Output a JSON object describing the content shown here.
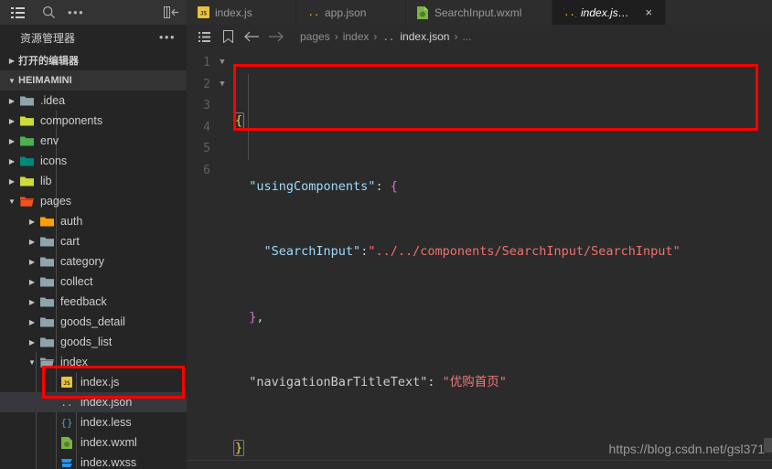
{
  "activity_bar": {
    "icons": [
      {
        "name": "menu-icon",
        "glyph": "menu"
      },
      {
        "name": "search-icon",
        "glyph": "search"
      },
      {
        "name": "more-actions-icon",
        "glyph": "ellipsis"
      }
    ],
    "collapse_label": "collapse-sidebar-icon"
  },
  "tabs": [
    {
      "label": "index.js",
      "icon": "js-file-icon",
      "active": false,
      "closable": false
    },
    {
      "label": "app.json",
      "icon": "json-file-icon",
      "active": false,
      "closable": false
    },
    {
      "label": "SearchInput.wxml",
      "icon": "wxml-file-icon",
      "active": false,
      "closable": false
    },
    {
      "label": "index.json",
      "icon": "json-file-icon",
      "active": true,
      "closable": true,
      "close_label": "×"
    }
  ],
  "sidebar": {
    "title": "资源管理器",
    "more_label": "•••",
    "sections": [
      {
        "label": "打开的编辑器",
        "expanded": false
      },
      {
        "label": "HEIMAMINI",
        "expanded": true
      }
    ],
    "tree": [
      {
        "label": ".idea",
        "depth": 1,
        "type": "folder",
        "color": "#90a4ae",
        "expanded": false,
        "selected": false
      },
      {
        "label": "components",
        "depth": 1,
        "type": "folder",
        "color": "#cddc39",
        "expanded": false,
        "selected": false
      },
      {
        "label": "env",
        "depth": 1,
        "type": "folder",
        "color": "#4caf50",
        "expanded": false,
        "selected": false
      },
      {
        "label": "icons",
        "depth": 1,
        "type": "folder",
        "color": "#00897b",
        "expanded": false,
        "selected": false
      },
      {
        "label": "lib",
        "depth": 1,
        "type": "folder",
        "color": "#cddc39",
        "expanded": false,
        "selected": false
      },
      {
        "label": "pages",
        "depth": 1,
        "type": "folder",
        "color": "#f4511e",
        "expanded": true,
        "selected": false
      },
      {
        "label": "auth",
        "depth": 2,
        "type": "folder",
        "color": "#ffa000",
        "expanded": false,
        "selected": false
      },
      {
        "label": "cart",
        "depth": 2,
        "type": "folder",
        "color": "#90a4ae",
        "expanded": false,
        "selected": false
      },
      {
        "label": "category",
        "depth": 2,
        "type": "folder",
        "color": "#90a4ae",
        "expanded": false,
        "selected": false
      },
      {
        "label": "collect",
        "depth": 2,
        "type": "folder",
        "color": "#90a4ae",
        "expanded": false,
        "selected": false
      },
      {
        "label": "feedback",
        "depth": 2,
        "type": "folder",
        "color": "#90a4ae",
        "expanded": false,
        "selected": false
      },
      {
        "label": "goods_detail",
        "depth": 2,
        "type": "folder",
        "color": "#90a4ae",
        "expanded": false,
        "selected": false
      },
      {
        "label": "goods_list",
        "depth": 2,
        "type": "folder",
        "color": "#90a4ae",
        "expanded": false,
        "selected": false
      },
      {
        "label": "index",
        "depth": 2,
        "type": "folder",
        "color": "#90a4ae",
        "expanded": true,
        "selected": false
      },
      {
        "label": "index.js",
        "depth": 3,
        "type": "js",
        "selected": false
      },
      {
        "label": "index.json",
        "depth": 3,
        "type": "json",
        "selected": true
      },
      {
        "label": "index.less",
        "depth": 3,
        "type": "less",
        "selected": false
      },
      {
        "label": "index.wxml",
        "depth": 3,
        "type": "wxml",
        "selected": false
      },
      {
        "label": "index.wxss",
        "depth": 3,
        "type": "wxss",
        "selected": false
      }
    ]
  },
  "breadcrumb": {
    "icons": [
      "outline-icon",
      "bookmark-icon",
      "back-arrow-icon",
      "forward-arrow-icon"
    ],
    "segments": [
      "pages",
      "index"
    ],
    "file": "index.json",
    "trailing": "...",
    "separator": "›"
  },
  "editor": {
    "lines": [
      {
        "number": "1",
        "foldable": true
      },
      {
        "number": "2",
        "foldable": true
      },
      {
        "number": "3",
        "foldable": false
      },
      {
        "number": "4",
        "foldable": false
      },
      {
        "number": "5",
        "foldable": false
      },
      {
        "number": "6",
        "foldable": false
      }
    ],
    "code": {
      "line1_brace": "{",
      "line2_key": "\"usingComponents\"",
      "line2_colon": ": ",
      "line2_brace": "{",
      "line3_key": "\"SearchInput\"",
      "line3_colon": ":",
      "line3_value": "\"../../components/SearchInput/SearchInput\"",
      "line4_brace": "}",
      "line4_comma": ",",
      "line5_key": "\"navigationBarTitleText\"",
      "line5_colon": ": ",
      "line5_value": "\"优购首页\"",
      "line6_brace": "}"
    },
    "colors": {
      "background": "#2b2b2b",
      "key": "#9cdcfe",
      "string": "#f07171",
      "brace_yellow": "#e8d44d",
      "brace_purple": "#da70d6",
      "annotation_red": "#ff0000"
    }
  },
  "annotations": [
    {
      "name": "code-highlight-box",
      "color": "#ff0000"
    },
    {
      "name": "file-highlight-box",
      "color": "#ff0000"
    }
  ],
  "watermark": {
    "text": "https://blog.csdn.net/gsl371"
  }
}
